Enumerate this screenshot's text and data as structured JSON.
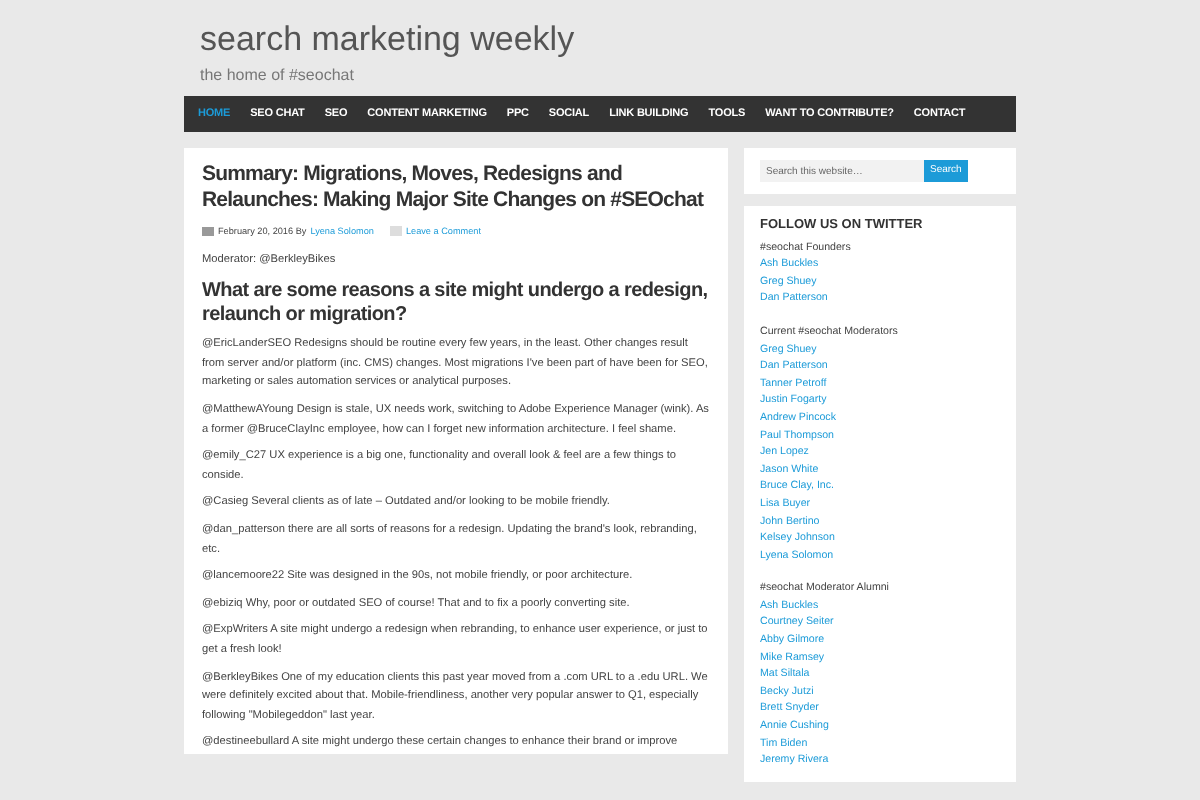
{
  "site": {
    "title": "search marketing weekly",
    "tagline": "the home of #seochat"
  },
  "nav": [
    {
      "label": "HOME",
      "selected": true
    },
    {
      "label": "SEO CHAT",
      "selected": false
    },
    {
      "label": "SEO",
      "selected": false
    },
    {
      "label": "CONTENT MARKETING",
      "selected": false
    },
    {
      "label": "PPC",
      "selected": false
    },
    {
      "label": "SOCIAL",
      "selected": false
    },
    {
      "label": "LINK BUILDING",
      "selected": false
    },
    {
      "label": "TOOLS",
      "selected": false
    },
    {
      "label": "WANT TO CONTRIBUTE?",
      "selected": false
    },
    {
      "label": "CONTACT",
      "selected": false
    }
  ],
  "article": {
    "title": "Summary: Migrations, Moves, Redesigns and Relaunches: Making Major Site Changes on #SEOchat",
    "meta": {
      "date": "February 20, 2016 By",
      "author": "Lyena Solomon",
      "comments": "Leave a Comment"
    },
    "moderator": "Moderator: @BerkleyBikes",
    "heading": "What are some reasons a site might undergo a redesign, relaunch or migration?",
    "paragraphs": [
      "@EricLanderSEO   Redesigns should be routine every few years, in the least. Other changes result from server and/or platform (inc. CMS) changes. Most migrations I've been part of have been for SEO, marketing or sales automation services or analytical purposes.",
      "@MatthewAYoung   Design is stale, UX needs work, switching to Adobe Experience Manager (wink). As a former @BruceClayInc employee, how can I forget new information architecture. I feel shame.",
      "@emily_C27   UX experience is a big one, functionality and overall look & feel are a few things to conside.",
      "@Casieg   Several clients as of late – Outdated and/or looking to be mobile friendly.",
      "@dan_patterson   there are all sorts of reasons for a redesign. Updating the brand's look, rebranding, etc.",
      "@lancemoore22   Site was designed in the 90s, not mobile friendly, or poor architecture.",
      "@ebiziq   Why, poor or outdated SEO of course! That and to fix a poorly converting site.",
      "@ExpWriters   A site might undergo a redesign when rebranding, to enhance user experience, or just to get a fresh look!",
      "@BerkleyBikes   One of my education clients this past year moved from a .com URL to a .edu URL. We were definitely excited about that. Mobile-friendliness, another very popular answer to Q1, especially following \"Mobilegeddon\" last year.",
      "@destineebullard   A site might undergo these certain changes to enhance their brand or improve"
    ]
  },
  "search": {
    "placeholder": "Search this website…",
    "button": "Search"
  },
  "twitter": {
    "heading": "FOLLOW US ON TWITTER",
    "groups": [
      {
        "title": "#seochat Founders",
        "names": [
          "Ash Buckles",
          "Greg Shuey",
          "Dan Patterson"
        ]
      },
      {
        "title": "Current #seochat Moderators",
        "names": [
          "Greg Shuey",
          "Dan Patterson",
          "Tanner Petroff",
          "Justin Fogarty",
          "Andrew Pincock",
          "Paul Thompson",
          "Jen Lopez",
          "Jason White",
          "Bruce Clay, Inc.",
          "Lisa Buyer",
          "John Bertino",
          "Kelsey Johnson",
          "Lyena Solomon"
        ]
      },
      {
        "title": "#seochat Moderator Alumni",
        "names": [
          "Ash Buckles",
          "Courtney Seiter",
          "Abby Gilmore",
          "Mike Ramsey",
          "Mat Siltala",
          "Becky Jutzi",
          "Brett Snyder",
          "Annie Cushing",
          "Tim Biden",
          "Jeremy Rivera"
        ]
      }
    ]
  }
}
